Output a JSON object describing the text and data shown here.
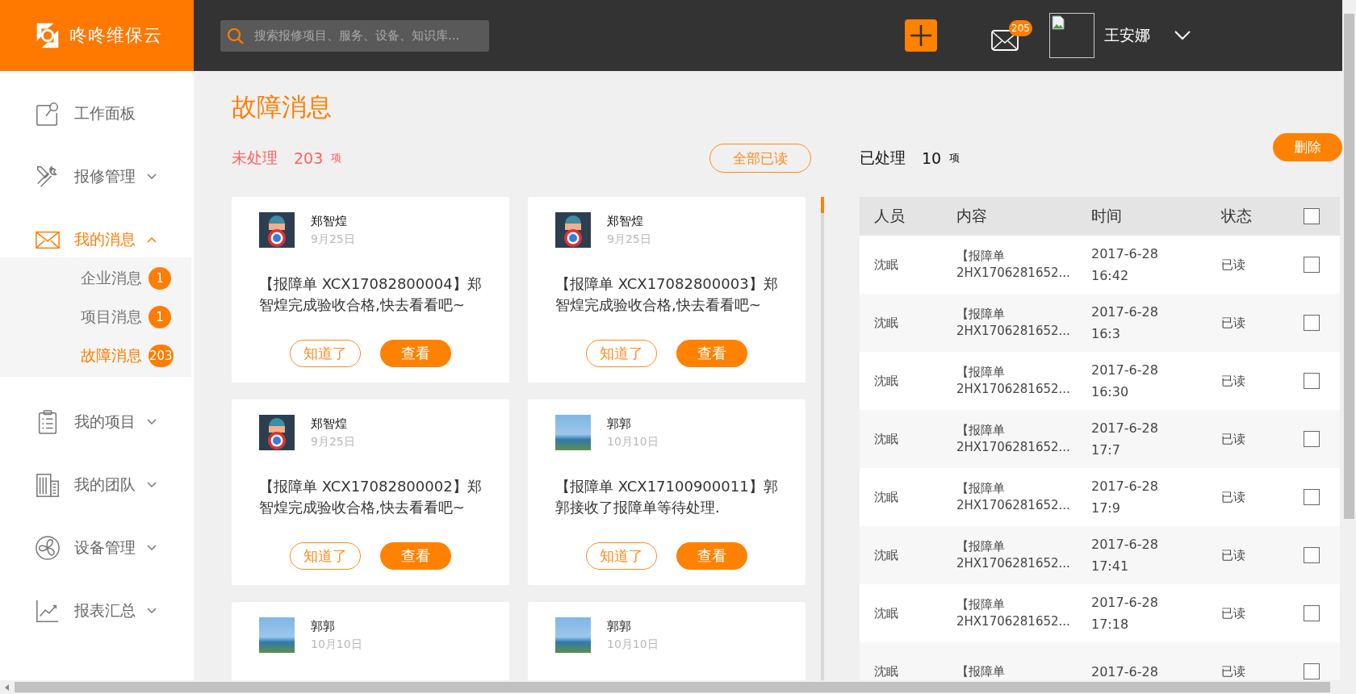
{
  "header": {
    "logo": "咚咚维保云",
    "search": {
      "placeholder": "搜索报修项目、服务、设备、知识库..."
    },
    "mail_badge": "205",
    "user": {
      "name": "王安娜"
    }
  },
  "sidebar": {
    "items": [
      {
        "label": "工作面板",
        "selected": false
      },
      {
        "label": "报修管理",
        "selected": false,
        "expanded": false
      },
      {
        "label": "我的消息",
        "selected": true,
        "expanded": true,
        "children": [
          {
            "label": "企业消息",
            "badge": "1",
            "selected": false
          },
          {
            "label": "项目消息",
            "badge": "1",
            "selected": false
          },
          {
            "label": "故障消息",
            "badge": "203",
            "selected": true
          }
        ]
      },
      {
        "label": "我的项目",
        "selected": false,
        "expanded": false
      },
      {
        "label": "我的团队",
        "selected": false,
        "expanded": false
      },
      {
        "label": "设备管理",
        "selected": false,
        "expanded": false
      },
      {
        "label": "报表汇总",
        "selected": false,
        "expanded": false
      }
    ]
  },
  "page": {
    "title": "故障消息"
  },
  "unprocessed": {
    "label": "未处理",
    "count": "203",
    "unit": "项",
    "mark_all_button": "全部已读",
    "cards": [
      {
        "name": "郑智煌",
        "date": "9月25日",
        "avatar": {
          "kind": "cartoon"
        },
        "message": "【报障单 XCX17082800004】郑智煌完成验收合格,快去看看吧~",
        "buttons": [
          {
            "label": "知道了",
            "kind": "outline"
          },
          {
            "label": "查看",
            "kind": "filled"
          }
        ]
      },
      {
        "name": "郑智煌",
        "date": "9月25日",
        "avatar": {
          "kind": "cartoon"
        },
        "message": "【报障单 XCX17082800003】郑智煌完成验收合格,快去看看吧~",
        "buttons": [
          {
            "label": "知道了",
            "kind": "outline"
          },
          {
            "label": "查看",
            "kind": "filled"
          }
        ]
      },
      {
        "name": "郑智煌",
        "date": "9月25日",
        "avatar": {
          "kind": "cartoon"
        },
        "message": "【报障单 XCX17082800002】郑智煌完成验收合格,快去看看吧~",
        "buttons": [
          {
            "label": "知道了",
            "kind": "outline"
          },
          {
            "label": "查看",
            "kind": "filled"
          }
        ]
      },
      {
        "name": "郭郭",
        "date": "10月10日",
        "avatar": {
          "kind": "photo"
        },
        "message": "【报障单 XCX17100900011】郭郭接收了报障单等待处理.",
        "buttons": [
          {
            "label": "知道了",
            "kind": "outline"
          },
          {
            "label": "查看",
            "kind": "filled"
          }
        ]
      },
      {
        "name": "郭郭",
        "date": "10月10日",
        "avatar": {
          "kind": "photo"
        }
      },
      {
        "name": "郭郭",
        "date": "10月10日",
        "avatar": {
          "kind": "photo"
        }
      }
    ]
  },
  "processed": {
    "label": "已处理",
    "count": "10",
    "unit": "项",
    "delete_button": "删除",
    "table": {
      "columns": [
        "人员",
        "内容",
        "时间",
        "状态"
      ],
      "select_all_checked": false,
      "rows": [
        {
          "person": "沈眠",
          "content": [
            "【报障单",
            "2HX1706281652..."
          ],
          "time": [
            "2017-6-28",
            "16:42"
          ],
          "status": "已读",
          "checked": false
        },
        {
          "person": "沈眠",
          "content": [
            "【报障单",
            "2HX1706281652..."
          ],
          "time": [
            "2017-6-28",
            "16:3"
          ],
          "status": "已读",
          "checked": false
        },
        {
          "person": "沈眠",
          "content": [
            "【报障单",
            "2HX1706281652..."
          ],
          "time": [
            "2017-6-28",
            "16:30"
          ],
          "status": "已读",
          "checked": false
        },
        {
          "person": "沈眠",
          "content": [
            "【报障单",
            "2HX1706281652..."
          ],
          "time": [
            "2017-6-28",
            "17:7"
          ],
          "status": "已读",
          "checked": false
        },
        {
          "person": "沈眠",
          "content": [
            "【报障单",
            "2HX1706281652..."
          ],
          "time": [
            "2017-6-28",
            "17:9"
          ],
          "status": "已读",
          "checked": false
        },
        {
          "person": "沈眠",
          "content": [
            "【报障单",
            "2HX1706281652..."
          ],
          "time": [
            "2017-6-28",
            "17:41"
          ],
          "status": "已读",
          "checked": false
        },
        {
          "person": "沈眠",
          "content": [
            "【报障单",
            "2HX1706281652..."
          ],
          "time": [
            "2017-6-28",
            "17:18"
          ],
          "status": "已读",
          "checked": false
        },
        {
          "person": "沈眠",
          "content": [
            "【报障单"
          ],
          "time": [
            "2017-6-28"
          ],
          "status": "已读",
          "checked": false
        }
      ]
    }
  }
}
